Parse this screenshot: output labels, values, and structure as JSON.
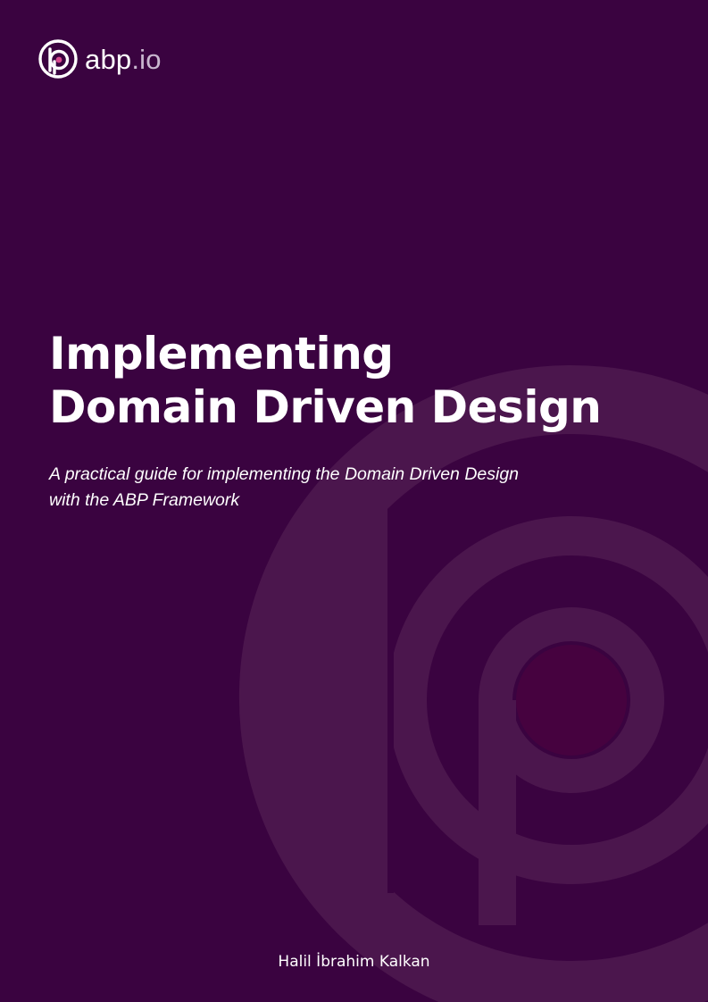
{
  "cover": {
    "brand": {
      "name": "abp",
      "suffix": ".io",
      "icon": "abp-logo-icon"
    },
    "title_lines": [
      "Implementing",
      "Domain Driven Design"
    ],
    "subtitle_lines": [
      "A practical guide for implementing the Domain Driven Design",
      "with the ABP Framework"
    ],
    "author": "Halil İbrahim Kalkan"
  },
  "colors": {
    "background": "#3a0340",
    "watermark": "#4b164d",
    "accent_dot": "#46023f",
    "text": "#ffffff",
    "brand_suffix": "#c9b7cf"
  }
}
